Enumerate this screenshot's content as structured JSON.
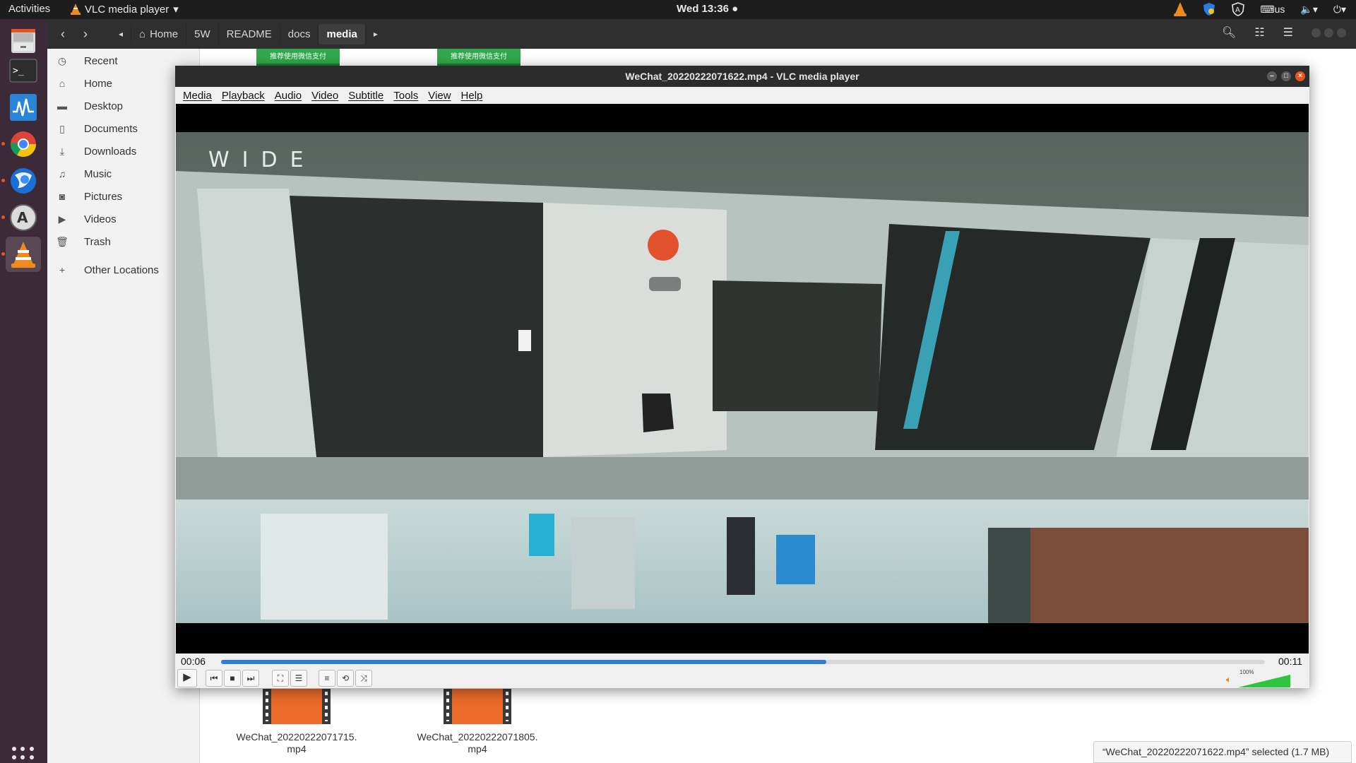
{
  "topbar": {
    "activities": "Activities",
    "app_name": "VLC media player",
    "clock": "Wed 13:36 ●",
    "keyboard": "us"
  },
  "file_manager": {
    "breadcrumbs": [
      "Home",
      "5W",
      "README",
      "docs",
      "media"
    ],
    "sidebar": [
      {
        "label": "Recent",
        "icon": "clock-icon"
      },
      {
        "label": "Home",
        "icon": "home-icon"
      },
      {
        "label": "Desktop",
        "icon": "folder-icon"
      },
      {
        "label": "Documents",
        "icon": "document-icon"
      },
      {
        "label": "Downloads",
        "icon": "download-icon"
      },
      {
        "label": "Music",
        "icon": "music-icon"
      },
      {
        "label": "Pictures",
        "icon": "camera-icon"
      },
      {
        "label": "Videos",
        "icon": "video-icon"
      },
      {
        "label": "Trash",
        "icon": "trash-icon"
      },
      {
        "label": "Other Locations",
        "icon": "plus-icon"
      }
    ],
    "thumb_banner_text": "推荐使用微信支付",
    "files": [
      {
        "name": "WeChat_20220222071715.\nmp4"
      },
      {
        "name": "WeChat_20220222071805.\nmp4"
      }
    ],
    "status": "“WeChat_20220222071622.mp4” selected  (1.7 MB)"
  },
  "vlc": {
    "title": "WeChat_20220222071622.mp4 - VLC media player",
    "menu": [
      "Media",
      "Playback",
      "Audio",
      "Video",
      "Subtitle",
      "Tools",
      "View",
      "Help"
    ],
    "video_overlay_text": "WIDE",
    "time_elapsed": "00:06",
    "time_total": "00:11",
    "progress_fraction": 0.58,
    "volume_label": "100%",
    "volume_fraction": 1.0
  },
  "colors": {
    "accent_orange": "#e95420",
    "progress_blue": "#2f7dd6",
    "volume_green": "#2ec43f"
  }
}
